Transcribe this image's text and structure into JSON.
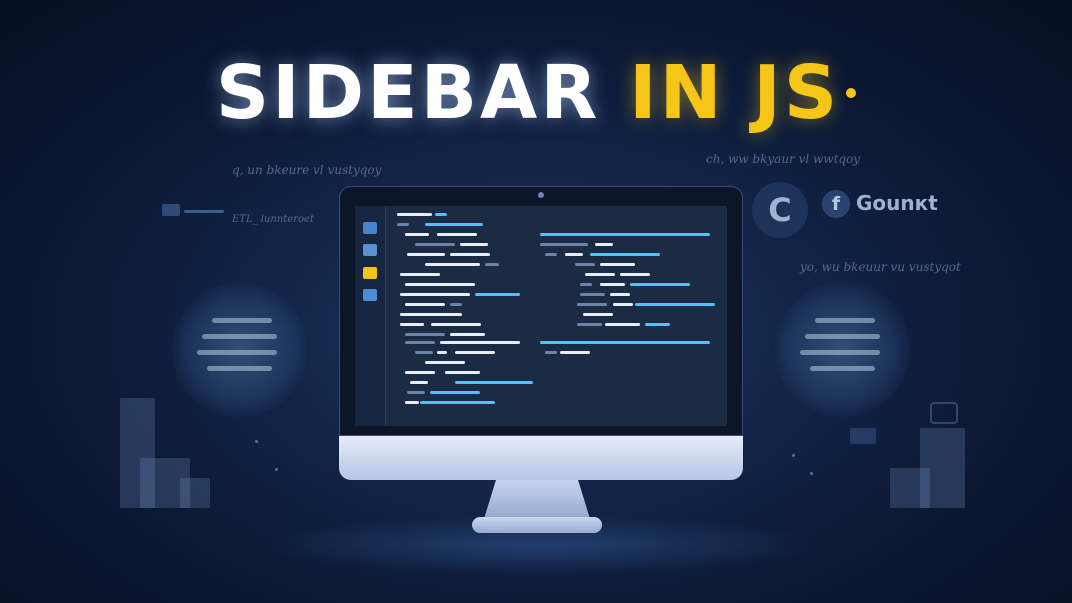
{
  "title": {
    "part1": "SIDEBAR",
    "part2": "IN JS"
  },
  "colors": {
    "background": "#0a1630",
    "title_white": "#ffffff",
    "title_yellow": "#f5c518",
    "code_blue": "#4fc3f7",
    "code_white": "#e8eef8"
  },
  "badges": {
    "c_letter": "C",
    "f_letter": "f",
    "label": "Gounкt"
  },
  "scribbles": {
    "top_left": "q, un bkeure vl vustyqoy",
    "left_mid": "ETL_ lunnteroet",
    "top_right": "ch, ww bkyaur vl wwtqoy",
    "right_mid": "yo, wu bkeuur vu vustyqot"
  },
  "icons": {
    "rail": [
      "file-icon",
      "folder-icon",
      "yellow-folder-icon",
      "image-icon"
    ],
    "left_orb": "menu-lines-icon",
    "right_orb": "menu-lines-icon"
  }
}
